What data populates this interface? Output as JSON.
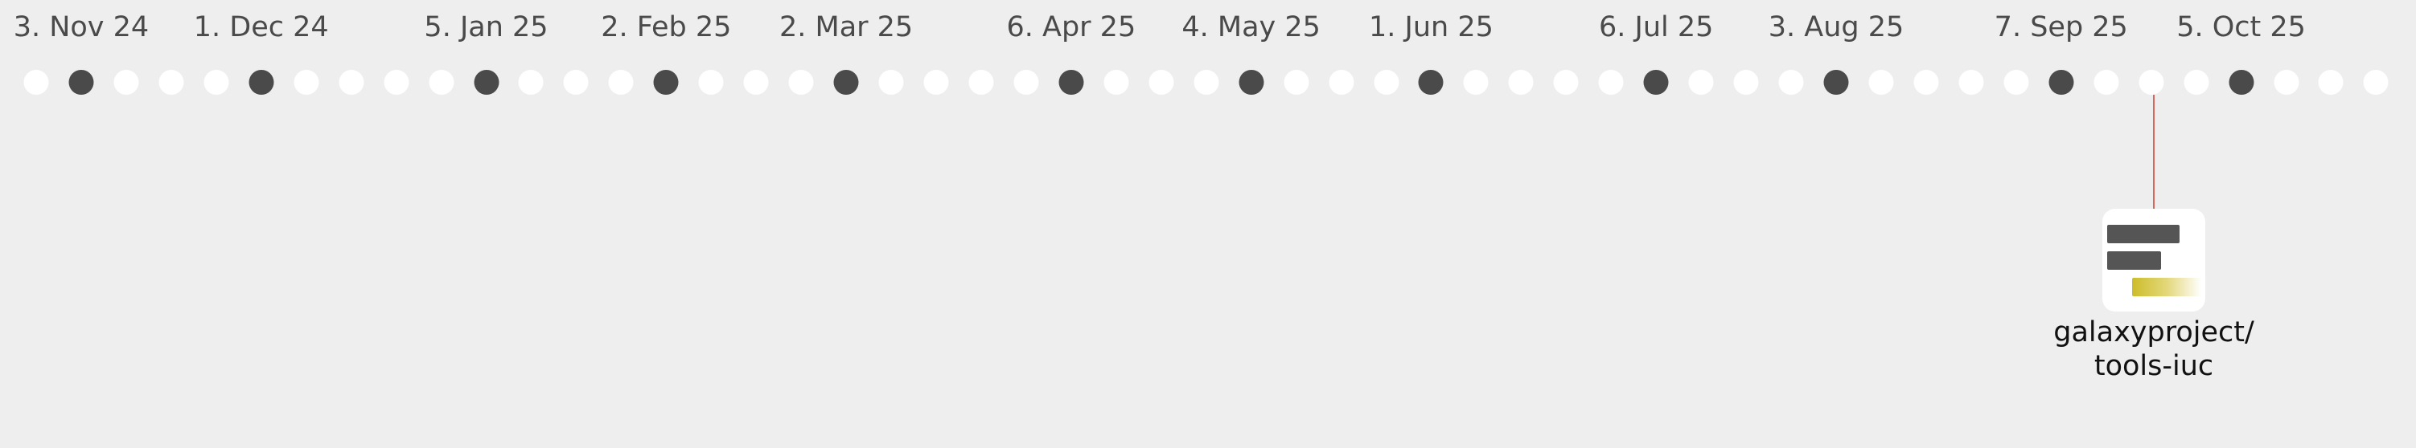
{
  "timeline": {
    "tick_labels": [
      {
        "text": "3. Nov 24"
      },
      {
        "text": "1. Dec 24"
      },
      {
        "text": "5. Jan 25"
      },
      {
        "text": "2. Feb 25"
      },
      {
        "text": "2. Mar 25"
      },
      {
        "text": "6. Apr 25"
      },
      {
        "text": "4. May 25"
      },
      {
        "text": "1. Jun 25"
      },
      {
        "text": "6. Jul 25"
      },
      {
        "text": "3. Aug 25"
      },
      {
        "text": "7. Sep 25"
      },
      {
        "text": "5. Oct 25"
      }
    ],
    "week_markers": "dark dot marks the start of each labeled month"
  },
  "event": {
    "repo_owner": "galaxyproject/",
    "repo_name": "tools-iuc",
    "icon": "repository-icon",
    "connector_color": "#d4675e",
    "accent_color": "#cdbd2a"
  }
}
